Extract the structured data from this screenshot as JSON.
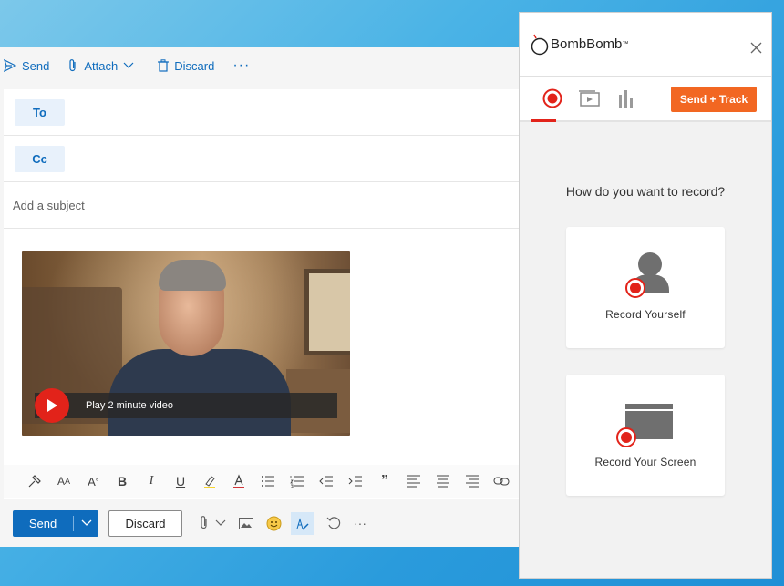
{
  "compose": {
    "toolbar": {
      "send": "Send",
      "attach": "Attach",
      "discard": "Discard",
      "more": "···"
    },
    "to_label": "To",
    "cc_label": "Cc",
    "subject_placeholder": "Add a subject",
    "video": {
      "caption": "Play 2 minute video"
    },
    "actions": {
      "send": "Send",
      "discard": "Discard",
      "more": "···"
    }
  },
  "panel": {
    "brand": "BombBomb",
    "brand_tm": "™",
    "send_track": "Send + Track",
    "question": "How do you want to record?",
    "options": [
      {
        "label": "Record Yourself"
      },
      {
        "label": "Record Your Screen"
      }
    ]
  },
  "colors": {
    "accent_blue": "#0f6cbd",
    "record_red": "#e2231a",
    "orange": "#f26722"
  }
}
